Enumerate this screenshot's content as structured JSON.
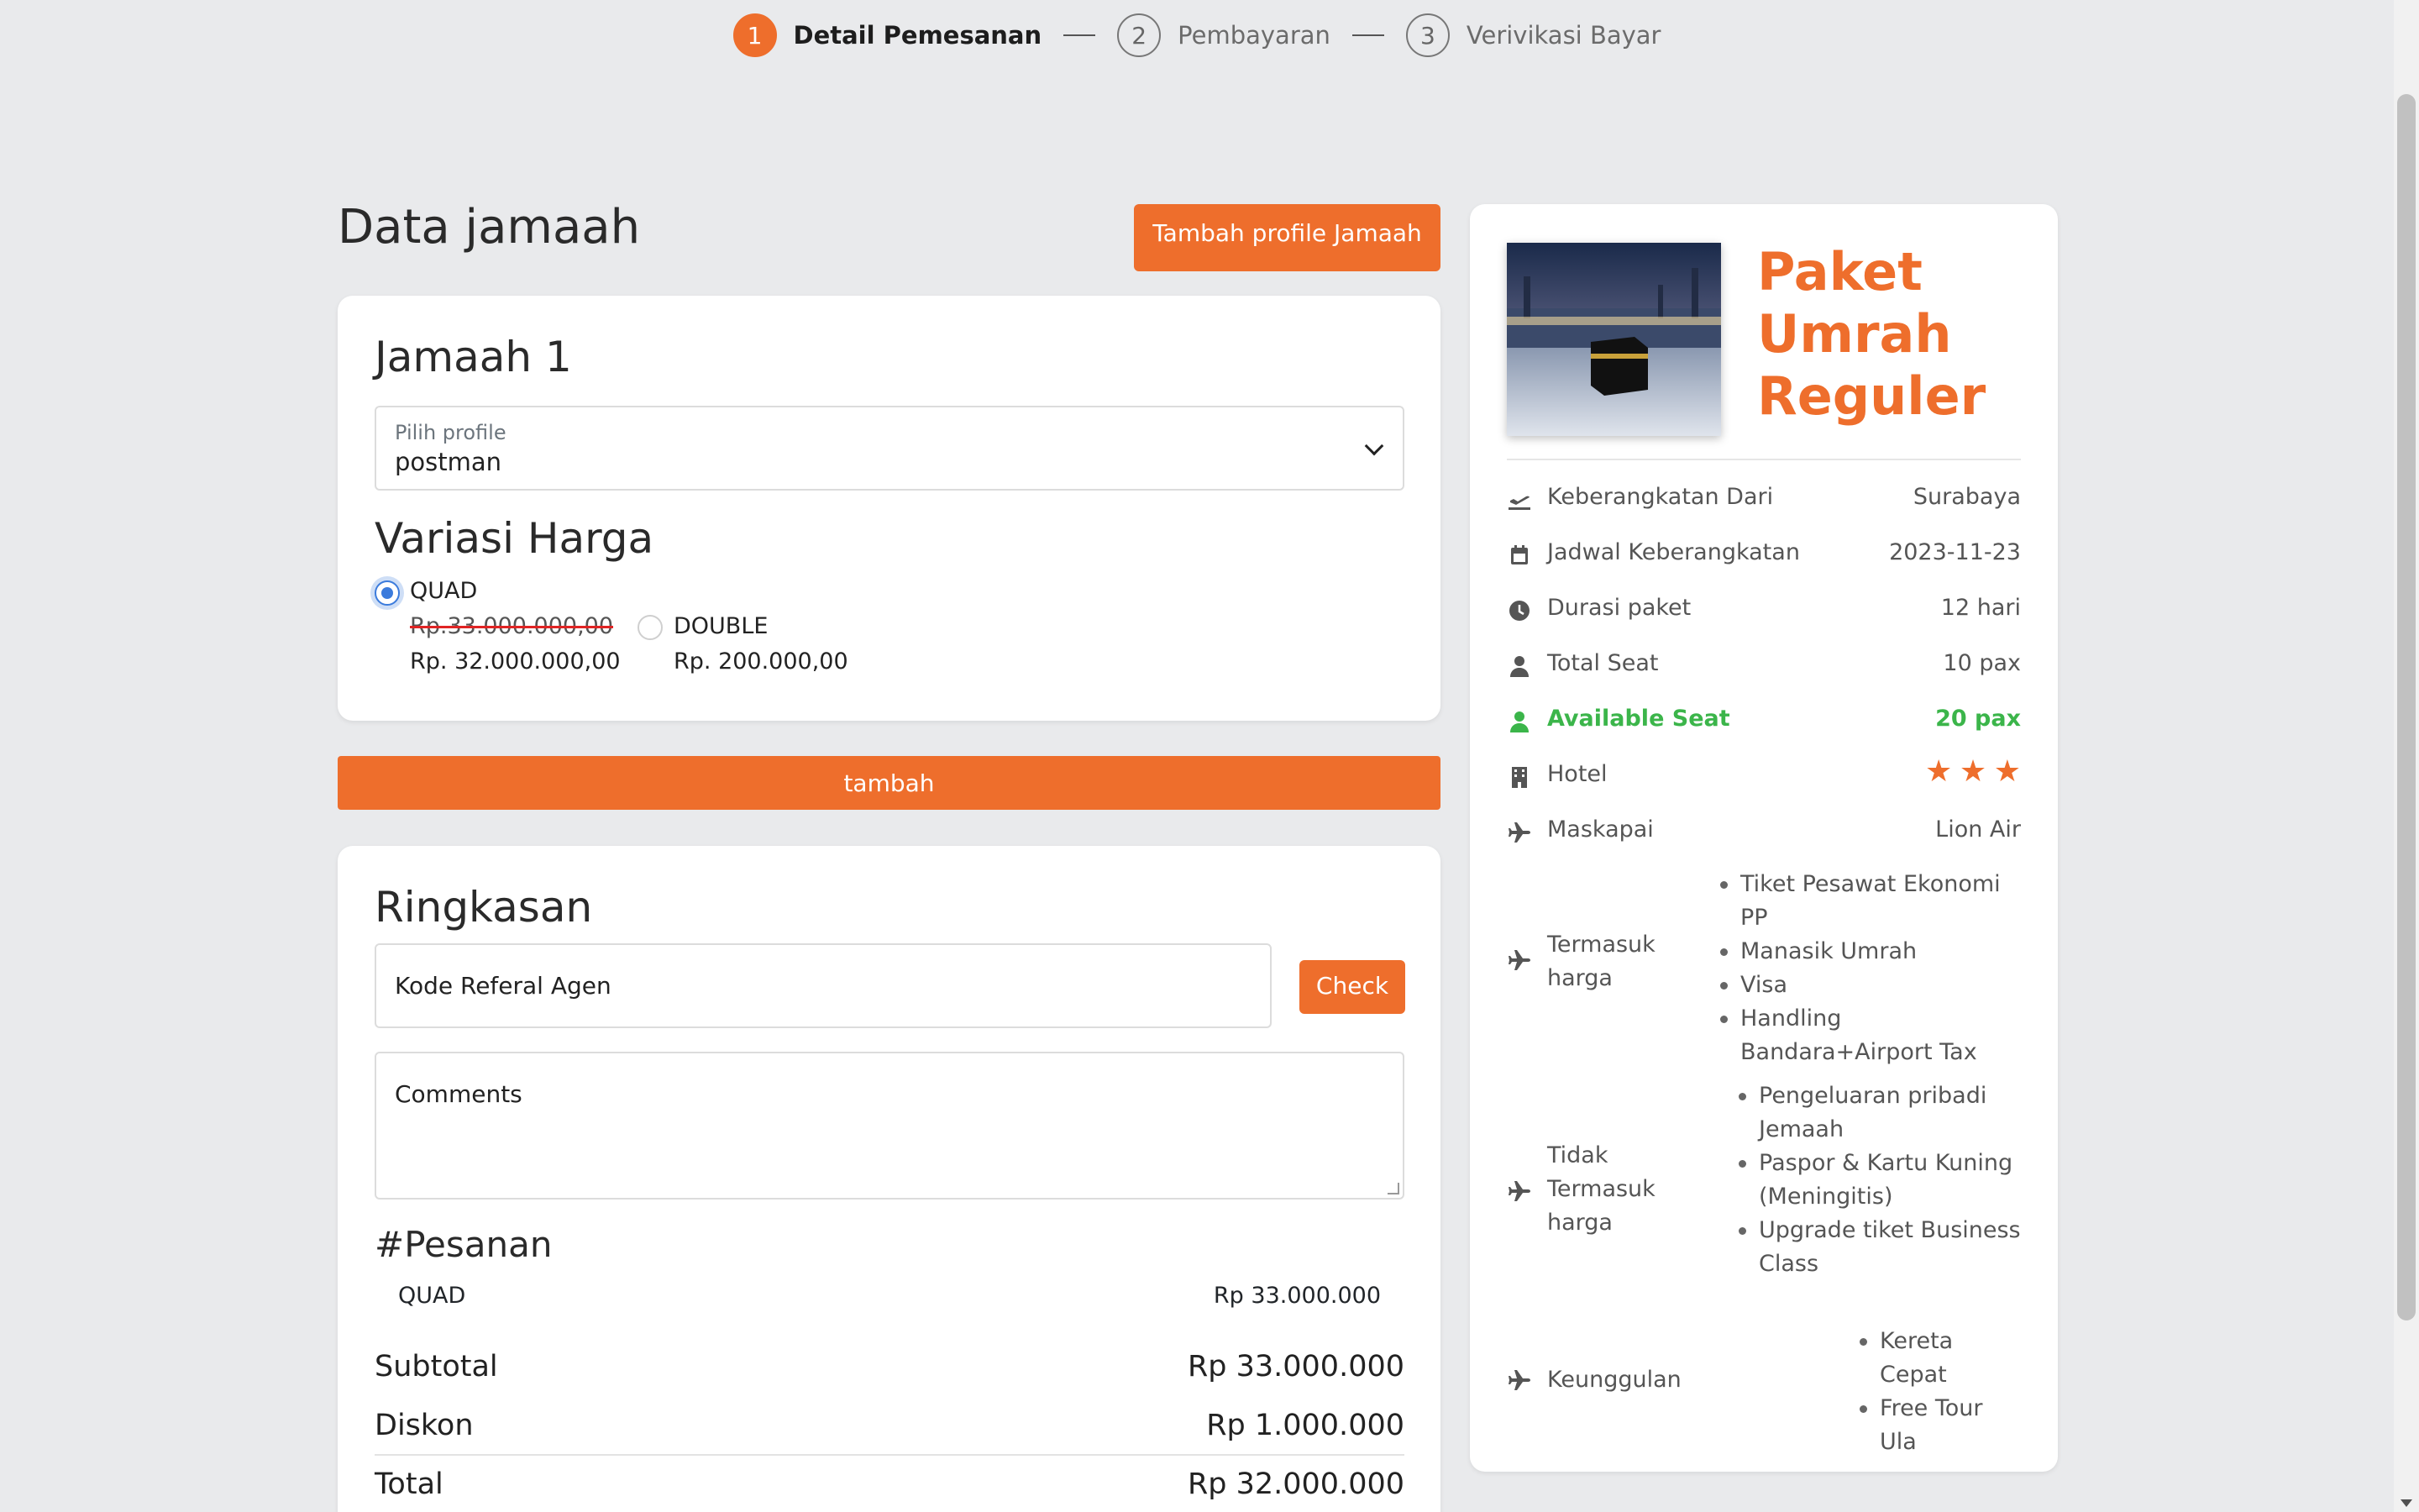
{
  "stepper": {
    "steps": [
      {
        "num": "1",
        "label": "Detail Pemesanan"
      },
      {
        "num": "2",
        "label": "Pembayaran"
      },
      {
        "num": "3",
        "label": "Verivikasi Bayar"
      }
    ]
  },
  "page": {
    "title": "Data jamaah",
    "add_profile_button": "Tambah profile Jamaah"
  },
  "jamaah": {
    "heading": "Jamaah 1",
    "profile_select": {
      "label": "Pilih profile",
      "value": "postman"
    },
    "variasi_heading": "Variasi Harga",
    "options": [
      {
        "name": "QUAD",
        "old_price": "Rp.33.000.000,00",
        "price": "Rp. 32.000.000,00",
        "selected": true
      },
      {
        "name": "DOUBLE",
        "price": "Rp. 200.000,00",
        "selected": false
      }
    ]
  },
  "tambah_button": "tambah",
  "ringkasan": {
    "heading": "Ringkasan",
    "referral_placeholder": "Kode Referal Agen",
    "check_button": "Check",
    "comments_placeholder": "Comments",
    "order_heading": "#Pesanan",
    "order_items": [
      {
        "name": "QUAD",
        "price": "Rp 33.000.000"
      }
    ],
    "subtotal_label": "Subtotal",
    "subtotal_value": "Rp 33.000.000",
    "diskon_label": "Diskon",
    "diskon_value": "Rp 1.000.000",
    "total_label": "Total",
    "total_value": "Rp 32.000.000"
  },
  "paket": {
    "title": "Paket Umrah Reguler",
    "image_icon": "kaaba-photo",
    "info": {
      "keberangkatan_label": "Keberangkatan Dari",
      "keberangkatan_value": "Surabaya",
      "jadwal_label": "Jadwal Keberangkatan",
      "jadwal_value": "2023-11-23",
      "durasi_label": "Durasi paket",
      "durasi_value": "12 hari",
      "total_seat_label": "Total Seat",
      "total_seat_value": "10 pax",
      "available_label": "Available Seat",
      "available_value": "20 pax",
      "hotel_label": "Hotel",
      "hotel_stars": 3,
      "maskapai_label": "Maskapai",
      "maskapai_value": "Lion Air"
    },
    "termasuk_label": "Termasuk harga",
    "termasuk": [
      "Tiket Pesawat Ekonomi PP",
      "Manasik Umrah",
      "Visa",
      "Handling Bandara+Airport Tax"
    ],
    "tidak_label": "Tidak Termasuk harga",
    "tidak_termasuk": [
      "Pengeluaran pribadi Jemaah",
      "Paspor & Kartu Kuning (Meningitis)",
      "Upgrade tiket Business Class"
    ],
    "keunggulan_label": "Keunggulan",
    "keunggulan": [
      "Kereta Cepat",
      "Free Tour Ula"
    ]
  },
  "colors": {
    "accent": "#ee6e2c",
    "success": "#3bb54a",
    "radio": "#3b7bdc"
  }
}
